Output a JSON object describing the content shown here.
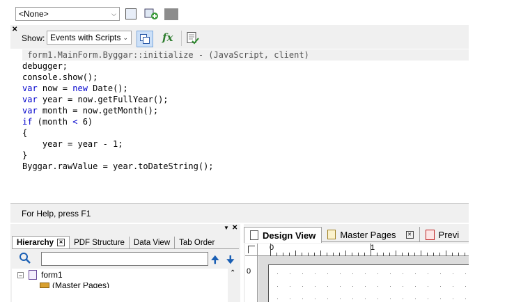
{
  "top_toolbar": {
    "combo_value": "<None>"
  },
  "script_editor": {
    "show_label": "Show:",
    "show_combo_value": "Events with Scripts",
    "fx_label": "fx",
    "event_header": " form1.MainForm.Byggar::initialize - (JavaScript, client)",
    "code_lines": [
      [
        {
          "t": "debugger;"
        }
      ],
      [
        {
          "t": "console.show();"
        }
      ],
      [
        {
          "t": "var",
          "k": 1
        },
        {
          "t": " now = "
        },
        {
          "t": "new",
          "k": 1
        },
        {
          "t": " Date();"
        }
      ],
      [
        {
          "t": "var",
          "k": 1
        },
        {
          "t": " year = now.getFullYear();"
        }
      ],
      [
        {
          "t": "var",
          "k": 1
        },
        {
          "t": " month = now.getMonth();"
        }
      ],
      [
        {
          "t": "if",
          "k": 1
        },
        {
          "t": " (month "
        },
        {
          "t": "<",
          "k": 1
        },
        {
          "t": " 6)"
        }
      ],
      [
        {
          "t": "{"
        }
      ],
      [
        {
          "t": "    year = year - 1;"
        }
      ],
      [
        {
          "t": "}"
        }
      ],
      [
        {
          "t": "Byggar.rawValue = year.toDateString();"
        }
      ]
    ]
  },
  "status_bar": {
    "text": "For Help, press F1"
  },
  "left_panel": {
    "tabs": [
      "Hierarchy",
      "PDF Structure",
      "Data View",
      "Tab Order"
    ],
    "tree": {
      "root_label": "form1",
      "child_label": "(Master Pages)"
    }
  },
  "right_panel": {
    "tabs": [
      "Design View",
      "Master Pages",
      "Previ"
    ],
    "ruler": {
      "h_labels": [
        "0",
        "1"
      ],
      "v_label": "0"
    }
  }
}
